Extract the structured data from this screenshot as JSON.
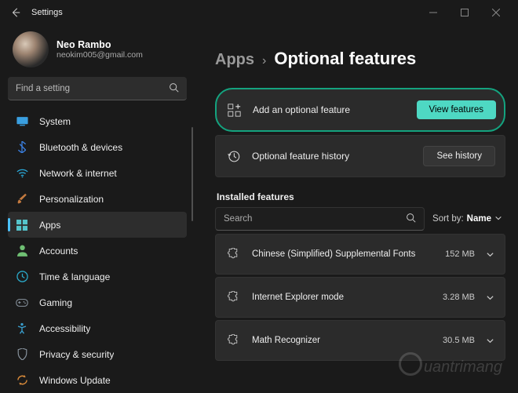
{
  "window": {
    "title": "Settings"
  },
  "profile": {
    "name": "Neo Rambo",
    "email": "neokim005@gmail.com"
  },
  "search": {
    "placeholder": "Find a setting"
  },
  "sidebar": {
    "active_index": 4,
    "items": [
      {
        "label": "System",
        "icon": "system",
        "color": "#3a9fe0"
      },
      {
        "label": "Bluetooth & devices",
        "icon": "bluetooth",
        "color": "#3a7fe0"
      },
      {
        "label": "Network & internet",
        "icon": "wifi",
        "color": "#2aa8d8"
      },
      {
        "label": "Personalization",
        "icon": "brush",
        "color": "#c47a3f"
      },
      {
        "label": "Apps",
        "icon": "apps",
        "color": "#55c5cc"
      },
      {
        "label": "Accounts",
        "icon": "person",
        "color": "#6fbf73"
      },
      {
        "label": "Time & language",
        "icon": "clock",
        "color": "#2aa8c8"
      },
      {
        "label": "Gaming",
        "icon": "gaming",
        "color": "#7a8590"
      },
      {
        "label": "Accessibility",
        "icon": "access",
        "color": "#3aa0d0"
      },
      {
        "label": "Privacy & security",
        "icon": "shield",
        "color": "#7a8590"
      },
      {
        "label": "Windows Update",
        "icon": "update",
        "color": "#d88a3a"
      }
    ]
  },
  "breadcrumb": {
    "parent": "Apps",
    "current": "Optional features"
  },
  "cards": {
    "add": {
      "label": "Add an optional feature",
      "button": "View features"
    },
    "history": {
      "label": "Optional feature history",
      "button": "See history"
    }
  },
  "installed": {
    "heading": "Installed features",
    "search_placeholder": "Search",
    "sort_label": "Sort by:",
    "sort_value": "Name",
    "items": [
      {
        "name": "Chinese (Simplified) Supplemental Fonts",
        "size": "152 MB"
      },
      {
        "name": "Internet Explorer mode",
        "size": "3.28 MB"
      },
      {
        "name": "Math Recognizer",
        "size": "30.5 MB"
      }
    ]
  },
  "watermark": "uantrimang"
}
